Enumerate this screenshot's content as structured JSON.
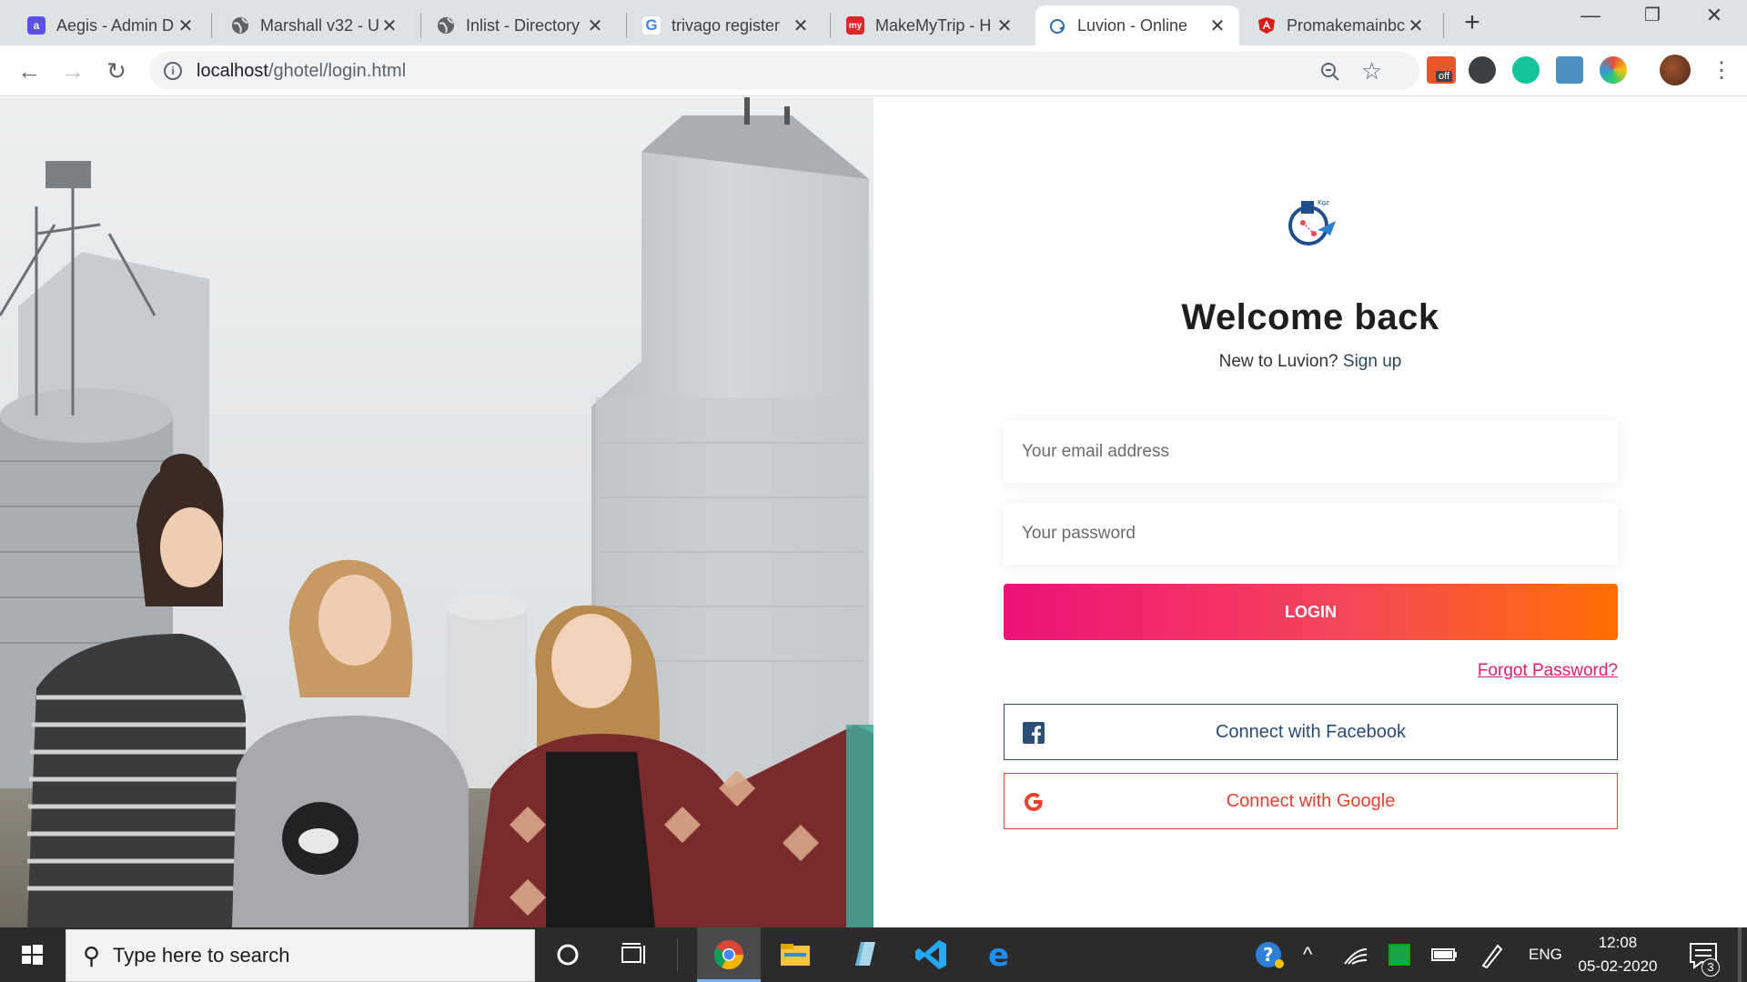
{
  "browser": {
    "tabs": [
      {
        "title": "Aegis - Admin D",
        "icon": "aegis-icon",
        "color": "#5b4ff5"
      },
      {
        "title": "Marshall v32 - U",
        "icon": "globe-icon",
        "color": "#5f6368"
      },
      {
        "title": "Inlist - Directory",
        "icon": "globe-icon",
        "color": "#5f6368"
      },
      {
        "title": "trivago register",
        "icon": "google-icon",
        "color": "#4285f4"
      },
      {
        "title": "MakeMyTrip - H",
        "icon": "makemytrip-icon",
        "color": "#e0262b"
      },
      {
        "title": "Luvion - Online",
        "icon": "luvion-icon",
        "color": "#2b6cb0"
      },
      {
        "title": "Promakemainbc",
        "icon": "angular-icon",
        "color": "#dd1b16"
      }
    ],
    "active_tab_index": 5,
    "new_tab_symbol": "+",
    "url_host": "localhost",
    "url_path": "/ghotel/login.html",
    "extension_badge": "off"
  },
  "page": {
    "title": "Welcome back",
    "subtitle_prefix": "New to Luvion?",
    "signup_link": "Sign up",
    "email_placeholder": "Your email address",
    "password_placeholder": "Your password",
    "login_label": "LOGIN",
    "forgot_label": "Forgot Password?",
    "facebook_label": "Connect with Facebook",
    "google_label": "Connect with Google",
    "colors": {
      "gradient_start": "#ed1177",
      "gradient_end": "#ff6f00",
      "facebook": "#2b4a74",
      "google": "#e8412e",
      "link": "#e0206a"
    }
  },
  "taskbar": {
    "search_placeholder": "Type here to search",
    "language": "ENG",
    "time": "12:08",
    "date": "05-02-2020",
    "notification_count": "3"
  }
}
